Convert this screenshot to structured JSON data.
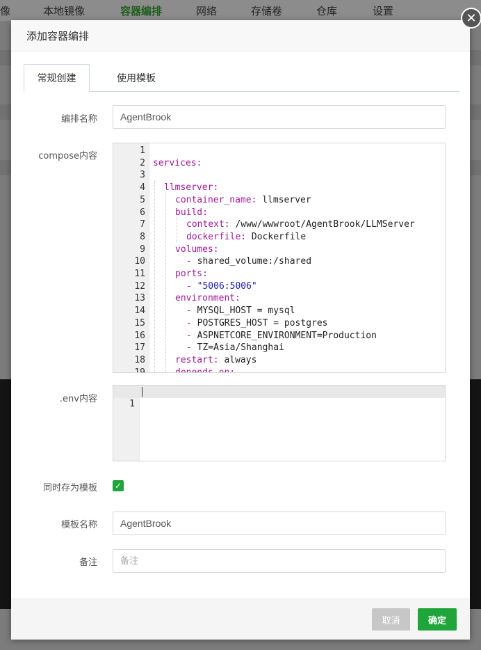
{
  "background_nav": {
    "items": [
      "像",
      "本地镜像",
      "容器编排",
      "网络",
      "存储卷",
      "仓库",
      "设置"
    ],
    "active_index": 2
  },
  "modal": {
    "title": "添加容器编排",
    "close_icon": "close-icon",
    "tabs": [
      {
        "label": "常规创建",
        "active": true
      },
      {
        "label": "使用模板",
        "active": false
      }
    ],
    "fields": {
      "name": {
        "label": "编排名称",
        "value": "AgentBrook"
      },
      "compose": {
        "label": "compose内容",
        "lines": [
          {
            "n": "1",
            "text": ""
          },
          {
            "n": "2",
            "key": "services:",
            "val": ""
          },
          {
            "n": "3",
            "text": ""
          },
          {
            "n": "4",
            "key": "llmserver:",
            "val": ""
          },
          {
            "n": "5",
            "key": "container_name:",
            "val": " llmserver"
          },
          {
            "n": "6",
            "key": "build:",
            "val": ""
          },
          {
            "n": "7",
            "key": "context:",
            "val": " /www/wwwroot/AgentBrook/LLMServer"
          },
          {
            "n": "8",
            "key": "dockerfile:",
            "val": " Dockerfile"
          },
          {
            "n": "9",
            "key": "volumes:",
            "val": ""
          },
          {
            "n": "10",
            "dash": true,
            "val": "shared_volume:/shared"
          },
          {
            "n": "11",
            "key": "ports:",
            "val": ""
          },
          {
            "n": "12",
            "dash": true,
            "str": "\"5006:5006\""
          },
          {
            "n": "13",
            "key": "environment:",
            "val": ""
          },
          {
            "n": "14",
            "dash": true,
            "val": "MYSQL_HOST = mysql"
          },
          {
            "n": "15",
            "dash": true,
            "val": "POSTGRES_HOST = postgres"
          },
          {
            "n": "16",
            "dash": true,
            "val": "ASPNETCORE_ENVIRONMENT=Production"
          },
          {
            "n": "17",
            "dash": true,
            "val": "TZ=Asia/Shanghai"
          },
          {
            "n": "18",
            "key": "restart:",
            "val": " always"
          },
          {
            "n": "19",
            "key": "depends_on:",
            "val": ""
          }
        ]
      },
      "env": {
        "label": ".env内容",
        "lines": [
          {
            "n": "1",
            "text": ""
          }
        ]
      },
      "save_template": {
        "label": "同时存为模板",
        "checked": true
      },
      "template_name": {
        "label": "模板名称",
        "value": "AgentBrook"
      },
      "remark": {
        "label": "备注",
        "placeholder": "备注",
        "value": ""
      }
    },
    "buttons": {
      "cancel": "取消",
      "confirm": "确定"
    }
  },
  "colors": {
    "accent": "#20a53a",
    "yaml_key": "#a11a9a",
    "yaml_string": "#1a1aa6"
  }
}
